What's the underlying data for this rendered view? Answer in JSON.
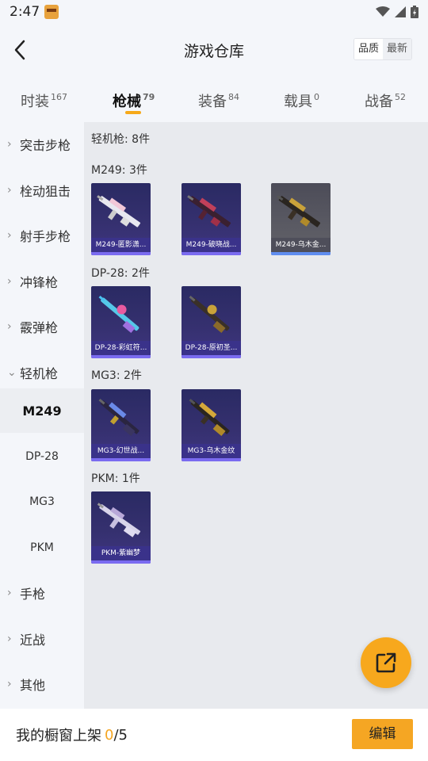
{
  "status": {
    "time": "2:47"
  },
  "header": {
    "title": "游戏仓库",
    "sort_quality": "品质",
    "sort_latest": "最新"
  },
  "tabs": [
    {
      "label": "时装",
      "count": "167"
    },
    {
      "label": "枪械",
      "count": "79",
      "active": true
    },
    {
      "label": "装备",
      "count": "84"
    },
    {
      "label": "载具",
      "count": "0"
    },
    {
      "label": "战备",
      "count": "52"
    }
  ],
  "sidebar": {
    "categories": [
      "突击步枪",
      "栓动狙击",
      "射手步枪",
      "冲锋枪",
      "霰弹枪",
      "轻机枪"
    ],
    "sub_items": [
      "M249",
      "DP-28",
      "MG3",
      "PKM"
    ],
    "more_categories": [
      "手枪",
      "近战",
      "其他"
    ]
  },
  "content": {
    "summary": "轻机枪: 8件",
    "groups": [
      {
        "title": "M249: 3件",
        "items": [
          {
            "name": "M249-匿影潇...",
            "rarity": "epic",
            "icon": "m249-light-gun-icon"
          },
          {
            "name": "M249-破晓战...",
            "rarity": "epic",
            "icon": "m249-red-gun-icon"
          },
          {
            "name": "M249-乌木金...",
            "rarity": "rare",
            "icon": "m249-gold-gun-icon"
          }
        ]
      },
      {
        "title": "DP-28: 2件",
        "items": [
          {
            "name": "DP-28-彩虹符...",
            "rarity": "epic",
            "icon": "dp28-rainbow-gun-icon"
          },
          {
            "name": "DP-28-原初圣...",
            "rarity": "epic",
            "icon": "dp28-gold-gun-icon"
          }
        ]
      },
      {
        "title": "MG3: 2件",
        "items": [
          {
            "name": "MG3-幻世战...",
            "rarity": "epic",
            "icon": "mg3-blue-gun-icon"
          },
          {
            "name": "MG3-乌木金纹",
            "rarity": "epic",
            "icon": "mg3-gold-gun-icon"
          }
        ]
      },
      {
        "title": "PKM: 1件",
        "items": [
          {
            "name": "PKM-紫幽梦",
            "rarity": "epic",
            "icon": "pkm-white-gun-icon"
          }
        ]
      }
    ]
  },
  "footer": {
    "label": "我的橱窗上架",
    "count": "0",
    "slash": "/",
    "total": "5",
    "edit_label": "编辑"
  },
  "colors": {
    "accent": "#f5a623",
    "epic_card": "#35306f",
    "rare_card": "#5a5a63"
  }
}
